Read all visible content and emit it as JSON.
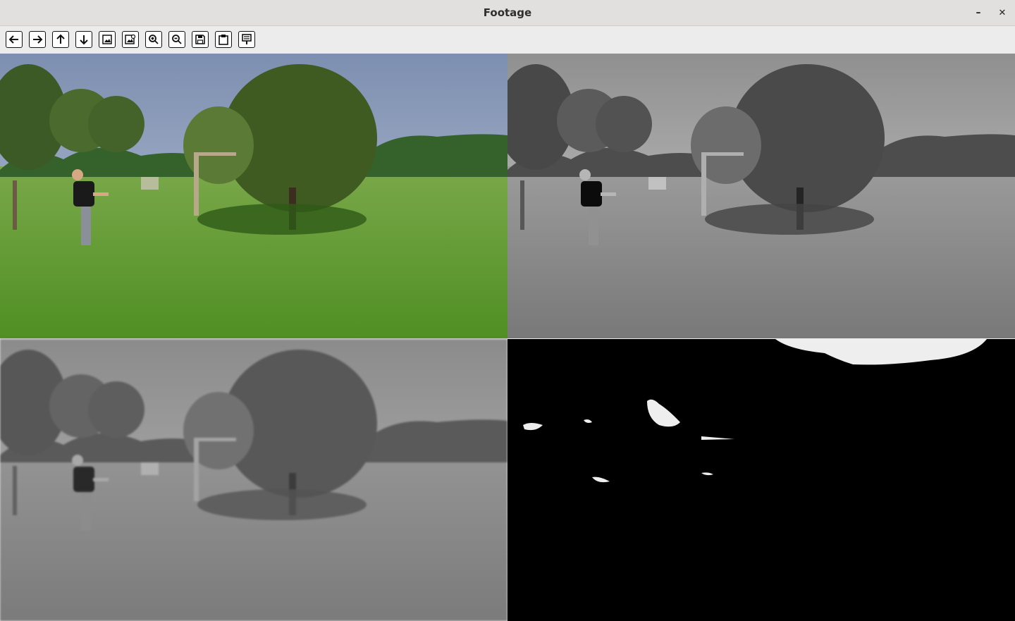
{
  "window": {
    "title": "Footage",
    "minimize_symbol": "–",
    "close_symbol": "✕"
  },
  "toolbar": {
    "buttons": [
      {
        "name": "back-arrow-icon"
      },
      {
        "name": "forward-arrow-icon"
      },
      {
        "name": "up-arrow-icon"
      },
      {
        "name": "down-arrow-icon"
      },
      {
        "name": "image-icon"
      },
      {
        "name": "image-settings-icon"
      },
      {
        "name": "zoom-in-icon"
      },
      {
        "name": "zoom-out-icon"
      },
      {
        "name": "save-icon"
      },
      {
        "name": "clipboard-icon"
      },
      {
        "name": "properties-icon"
      }
    ]
  },
  "panels": [
    {
      "name": "original-frame",
      "mode": "color"
    },
    {
      "name": "grayscale-frame",
      "mode": "grayscale"
    },
    {
      "name": "blurred-grayscale-frame",
      "mode": "grayscale-blurred"
    },
    {
      "name": "threshold-mask-frame",
      "mode": "binary"
    }
  ],
  "colors": {
    "sky": "#8fa3c4",
    "grass": "#5e9a2e",
    "tree": "#3f5b22",
    "hedge": "#2f5a24",
    "mask_white": "#eeeeee",
    "mask_black": "#000000"
  }
}
